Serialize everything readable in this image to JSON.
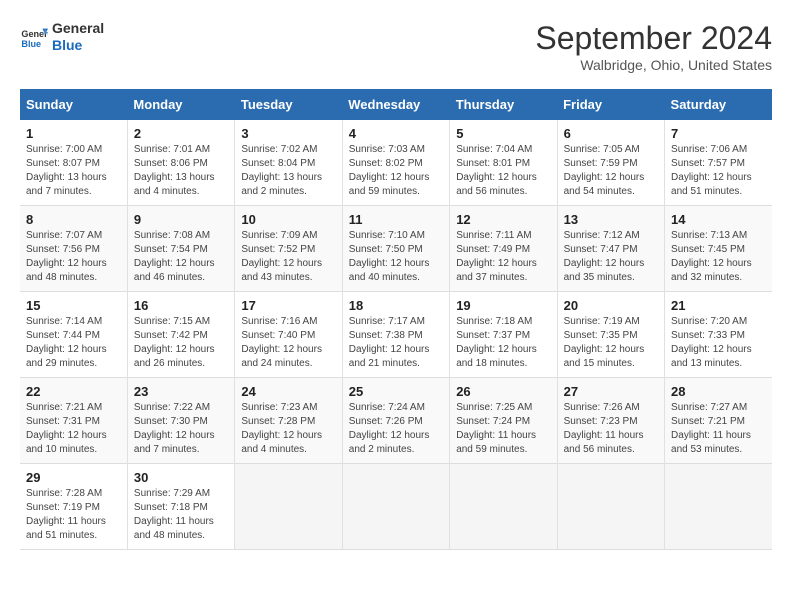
{
  "logo": {
    "line1": "General",
    "line2": "Blue"
  },
  "title": "September 2024",
  "subtitle": "Walbridge, Ohio, United States",
  "headers": [
    "Sunday",
    "Monday",
    "Tuesday",
    "Wednesday",
    "Thursday",
    "Friday",
    "Saturday"
  ],
  "weeks": [
    [
      {
        "num": "1",
        "rise": "7:00 AM",
        "set": "8:07 PM",
        "daylight": "13 hours and 7 minutes."
      },
      {
        "num": "2",
        "rise": "7:01 AM",
        "set": "8:06 PM",
        "daylight": "13 hours and 4 minutes."
      },
      {
        "num": "3",
        "rise": "7:02 AM",
        "set": "8:04 PM",
        "daylight": "13 hours and 2 minutes."
      },
      {
        "num": "4",
        "rise": "7:03 AM",
        "set": "8:02 PM",
        "daylight": "12 hours and 59 minutes."
      },
      {
        "num": "5",
        "rise": "7:04 AM",
        "set": "8:01 PM",
        "daylight": "12 hours and 56 minutes."
      },
      {
        "num": "6",
        "rise": "7:05 AM",
        "set": "7:59 PM",
        "daylight": "12 hours and 54 minutes."
      },
      {
        "num": "7",
        "rise": "7:06 AM",
        "set": "7:57 PM",
        "daylight": "12 hours and 51 minutes."
      }
    ],
    [
      {
        "num": "8",
        "rise": "7:07 AM",
        "set": "7:56 PM",
        "daylight": "12 hours and 48 minutes."
      },
      {
        "num": "9",
        "rise": "7:08 AM",
        "set": "7:54 PM",
        "daylight": "12 hours and 46 minutes."
      },
      {
        "num": "10",
        "rise": "7:09 AM",
        "set": "7:52 PM",
        "daylight": "12 hours and 43 minutes."
      },
      {
        "num": "11",
        "rise": "7:10 AM",
        "set": "7:50 PM",
        "daylight": "12 hours and 40 minutes."
      },
      {
        "num": "12",
        "rise": "7:11 AM",
        "set": "7:49 PM",
        "daylight": "12 hours and 37 minutes."
      },
      {
        "num": "13",
        "rise": "7:12 AM",
        "set": "7:47 PM",
        "daylight": "12 hours and 35 minutes."
      },
      {
        "num": "14",
        "rise": "7:13 AM",
        "set": "7:45 PM",
        "daylight": "12 hours and 32 minutes."
      }
    ],
    [
      {
        "num": "15",
        "rise": "7:14 AM",
        "set": "7:44 PM",
        "daylight": "12 hours and 29 minutes."
      },
      {
        "num": "16",
        "rise": "7:15 AM",
        "set": "7:42 PM",
        "daylight": "12 hours and 26 minutes."
      },
      {
        "num": "17",
        "rise": "7:16 AM",
        "set": "7:40 PM",
        "daylight": "12 hours and 24 minutes."
      },
      {
        "num": "18",
        "rise": "7:17 AM",
        "set": "7:38 PM",
        "daylight": "12 hours and 21 minutes."
      },
      {
        "num": "19",
        "rise": "7:18 AM",
        "set": "7:37 PM",
        "daylight": "12 hours and 18 minutes."
      },
      {
        "num": "20",
        "rise": "7:19 AM",
        "set": "7:35 PM",
        "daylight": "12 hours and 15 minutes."
      },
      {
        "num": "21",
        "rise": "7:20 AM",
        "set": "7:33 PM",
        "daylight": "12 hours and 13 minutes."
      }
    ],
    [
      {
        "num": "22",
        "rise": "7:21 AM",
        "set": "7:31 PM",
        "daylight": "12 hours and 10 minutes."
      },
      {
        "num": "23",
        "rise": "7:22 AM",
        "set": "7:30 PM",
        "daylight": "12 hours and 7 minutes."
      },
      {
        "num": "24",
        "rise": "7:23 AM",
        "set": "7:28 PM",
        "daylight": "12 hours and 4 minutes."
      },
      {
        "num": "25",
        "rise": "7:24 AM",
        "set": "7:26 PM",
        "daylight": "12 hours and 2 minutes."
      },
      {
        "num": "26",
        "rise": "7:25 AM",
        "set": "7:24 PM",
        "daylight": "11 hours and 59 minutes."
      },
      {
        "num": "27",
        "rise": "7:26 AM",
        "set": "7:23 PM",
        "daylight": "11 hours and 56 minutes."
      },
      {
        "num": "28",
        "rise": "7:27 AM",
        "set": "7:21 PM",
        "daylight": "11 hours and 53 minutes."
      }
    ],
    [
      {
        "num": "29",
        "rise": "7:28 AM",
        "set": "7:19 PM",
        "daylight": "11 hours and 51 minutes."
      },
      {
        "num": "30",
        "rise": "7:29 AM",
        "set": "7:18 PM",
        "daylight": "11 hours and 48 minutes."
      },
      null,
      null,
      null,
      null,
      null
    ]
  ],
  "labels": {
    "sunrise": "Sunrise:",
    "sunset": "Sunset:",
    "daylight": "Daylight:"
  }
}
